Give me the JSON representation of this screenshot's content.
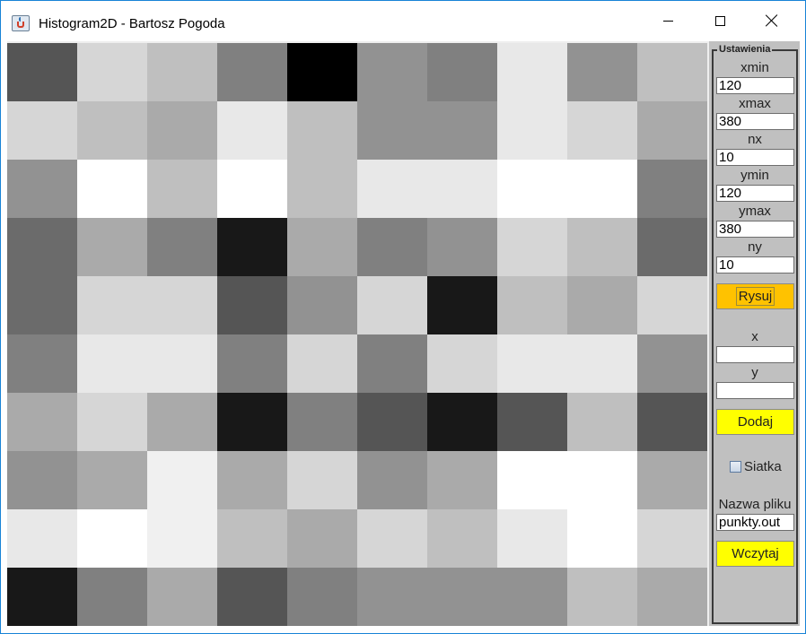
{
  "window": {
    "title": "Histogram2D - Bartosz Pogoda",
    "controls": {
      "minimize": "minimize-icon",
      "maximize": "maximize-icon",
      "close": "close-icon"
    }
  },
  "histogram": {
    "rows": 10,
    "cols": 10,
    "cells": [
      [
        "#555555",
        "#d6d6d6",
        "#bfbfbf",
        "#808080",
        "#000000",
        "#929292",
        "#808080",
        "#e8e8e8",
        "#929292",
        "#bfbfbf"
      ],
      [
        "#d6d6d6",
        "#bfbfbf",
        "#aaaaaa",
        "#e8e8e8",
        "#bfbfbf",
        "#929292",
        "#929292",
        "#e8e8e8",
        "#d6d6d6",
        "#aaaaaa"
      ],
      [
        "#929292",
        "#ffffff",
        "#bfbfbf",
        "#ffffff",
        "#bfbfbf",
        "#e8e8e8",
        "#e8e8e8",
        "#ffffff",
        "#ffffff",
        "#808080"
      ],
      [
        "#6b6b6b",
        "#aaaaaa",
        "#808080",
        "#181818",
        "#aaaaaa",
        "#808080",
        "#929292",
        "#d6d6d6",
        "#bfbfbf",
        "#6b6b6b"
      ],
      [
        "#6b6b6b",
        "#d6d6d6",
        "#d6d6d6",
        "#555555",
        "#929292",
        "#d6d6d6",
        "#181818",
        "#bfbfbf",
        "#aaaaaa",
        "#d6d6d6"
      ],
      [
        "#808080",
        "#e8e8e8",
        "#e8e8e8",
        "#808080",
        "#d6d6d6",
        "#808080",
        "#d6d6d6",
        "#e8e8e8",
        "#e8e8e8",
        "#929292"
      ],
      [
        "#aaaaaa",
        "#d6d6d6",
        "#aaaaaa",
        "#181818",
        "#808080",
        "#555555",
        "#181818",
        "#555555",
        "#bfbfbf",
        "#555555"
      ],
      [
        "#929292",
        "#aaaaaa",
        "#f0f0f0",
        "#aaaaaa",
        "#d6d6d6",
        "#929292",
        "#aaaaaa",
        "#ffffff",
        "#ffffff",
        "#aaaaaa"
      ],
      [
        "#e8e8e8",
        "#ffffff",
        "#f0f0f0",
        "#bfbfbf",
        "#aaaaaa",
        "#d6d6d6",
        "#bfbfbf",
        "#e8e8e8",
        "#ffffff",
        "#d6d6d6"
      ],
      [
        "#181818",
        "#808080",
        "#aaaaaa",
        "#555555",
        "#808080",
        "#929292",
        "#929292",
        "#929292",
        "#bfbfbf",
        "#aaaaaa"
      ]
    ]
  },
  "settings": {
    "legend": "Ustawienia",
    "xmin": {
      "label": "xmin",
      "value": "120"
    },
    "xmax": {
      "label": "xmax",
      "value": "380"
    },
    "nx": {
      "label": "nx",
      "value": "10"
    },
    "ymin": {
      "label": "ymin",
      "value": "120"
    },
    "ymax": {
      "label": "ymax",
      "value": "380"
    },
    "ny": {
      "label": "ny",
      "value": "10"
    },
    "draw_button": "Rysuj",
    "x": {
      "label": "x",
      "value": ""
    },
    "y": {
      "label": "y",
      "value": ""
    },
    "add_button": "Dodaj",
    "grid_checkbox": {
      "label": "Siatka",
      "checked": false
    },
    "filename": {
      "label": "Nazwa pliku",
      "value": "punkty.out"
    },
    "load_button": "Wczytaj"
  },
  "colors": {
    "draw_button": "#ffc200",
    "action_buttons": "#ffff00",
    "panel_background": "#c0c0c0"
  }
}
